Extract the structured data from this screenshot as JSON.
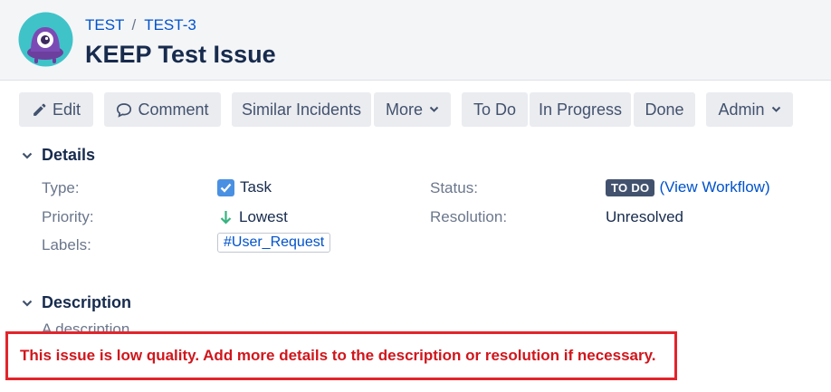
{
  "breadcrumb": {
    "project": "TEST",
    "separator": "/",
    "issue_key": "TEST-3"
  },
  "issue": {
    "title": "KEEP Test Issue"
  },
  "toolbar": {
    "edit": "Edit",
    "comment": "Comment",
    "similar": "Similar Incidents",
    "more": "More",
    "todo": "To Do",
    "in_progress": "In Progress",
    "done": "Done",
    "admin": "Admin"
  },
  "details": {
    "heading": "Details",
    "type_label": "Type:",
    "type_value": "Task",
    "priority_label": "Priority:",
    "priority_value": "Lowest",
    "labels_label": "Labels:",
    "labels_value": "#User_Request",
    "status_label": "Status:",
    "status_badge": "TO DO",
    "status_link": "(View Workflow)",
    "resolution_label": "Resolution:",
    "resolution_value": "Unresolved"
  },
  "description": {
    "heading": "Description",
    "text": "A description"
  },
  "warning": {
    "text": "This issue is low quality. Add more details to the description or resolution if necessary."
  },
  "colors": {
    "link": "#0052cc",
    "warning_red": "#e3242b",
    "badge_bg": "#42526e",
    "task_icon": "#4a90e2",
    "priority_lowest": "#36b37e"
  },
  "icons": [
    "project-avatar-icon",
    "pencil-icon",
    "comment-icon",
    "chevron-down-icon",
    "task-checkbox-icon",
    "arrow-down-icon"
  ]
}
